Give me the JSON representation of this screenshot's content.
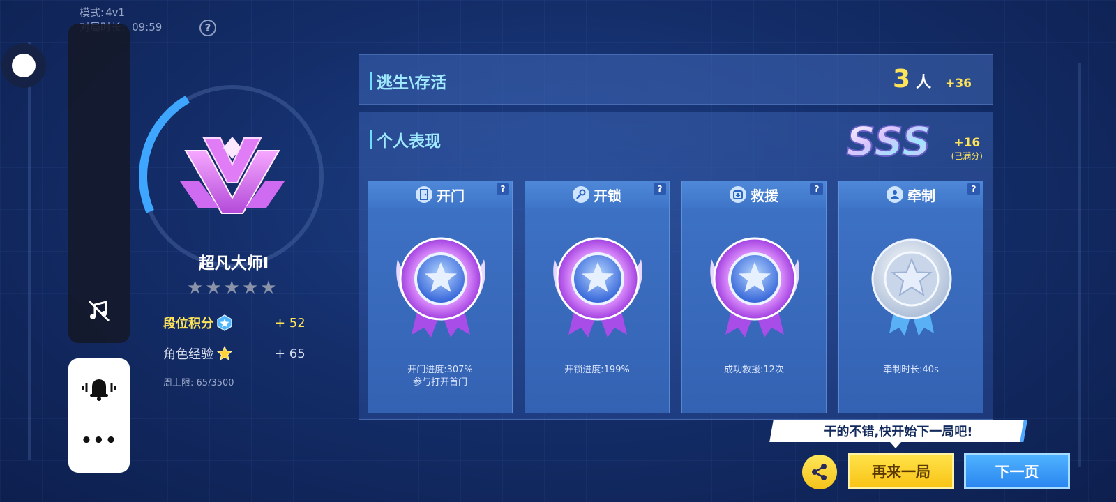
{
  "match_info": {
    "mode_label": "模式:",
    "mode_value": "4v1",
    "duration_label": "对局时长:",
    "duration_value": "09:59",
    "help_icon": "question-circle-icon"
  },
  "floating_controls": {
    "dot_icon": "assistive-touch-icon",
    "music_icon": "music-off-icon",
    "bell_icon": "bell-icon",
    "more_label": "•••"
  },
  "rank": {
    "name": "超凡大师I",
    "stars_total": 5,
    "stars_filled": 0,
    "progress": 0.42,
    "score_label": "段位积分",
    "score_value": "+ 52",
    "exp_label": "角色经验",
    "exp_value": "+ 65",
    "weekly_label": "周上限:",
    "weekly_value": "65/3500"
  },
  "escape": {
    "title": "逃生\\存活",
    "count": "3",
    "unit": "人",
    "bonus": "+36"
  },
  "performance": {
    "title": "个人表现",
    "grade": "SSS",
    "bonus": "+16",
    "note": "(已满分)",
    "cards": [
      {
        "title": "开门",
        "icon": "door-icon",
        "medal": "purple-star-medal",
        "desc1": "开门进度:307%",
        "desc2": "参与打开首门"
      },
      {
        "title": "开锁",
        "icon": "wrench-icon",
        "medal": "purple-star-medal",
        "desc1": "开锁进度:199%",
        "desc2": ""
      },
      {
        "title": "救援",
        "icon": "rescue-icon",
        "medal": "purple-star-medal",
        "desc1": "成功救援:12次",
        "desc2": ""
      },
      {
        "title": "牵制",
        "icon": "person-icon",
        "medal": "silver-star-medal",
        "desc1": "牵制时长:40s",
        "desc2": ""
      }
    ]
  },
  "actions": {
    "tip": "干的不错,快开始下一局吧!",
    "share_icon": "share-icon",
    "again_label": "再来一局",
    "next_label": "下一页"
  },
  "colors": {
    "accent_yellow": "#ffe45a",
    "accent_cyan": "#9ee9ff",
    "ring_blue": "#3ea6ff"
  }
}
